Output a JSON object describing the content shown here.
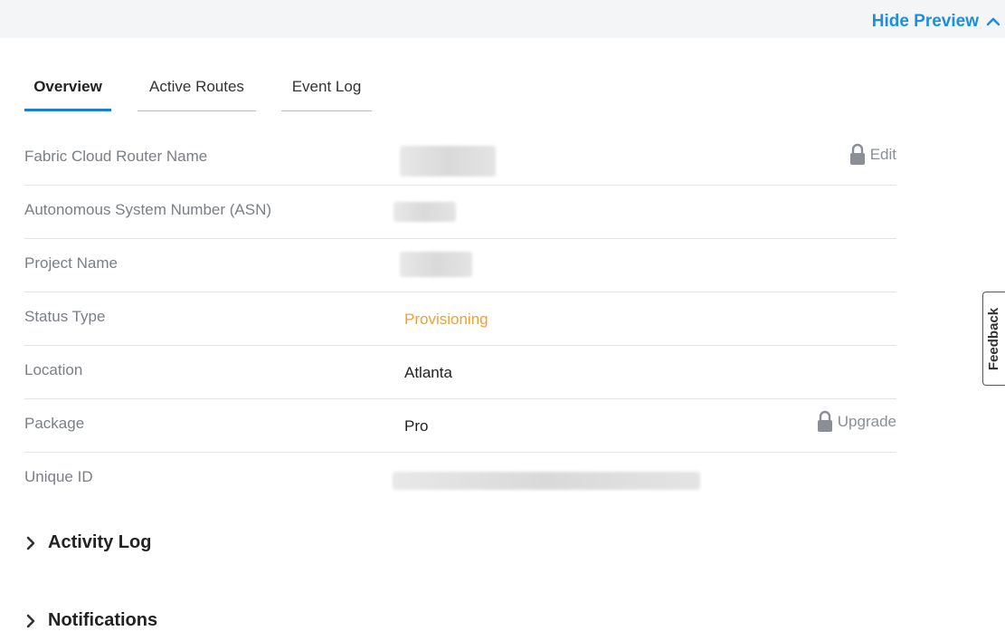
{
  "header": {
    "hide_preview_label": "Hide Preview"
  },
  "tabs": [
    {
      "label": "Overview",
      "active": true
    },
    {
      "label": "Active Routes",
      "active": false
    },
    {
      "label": "Event Log",
      "active": false
    }
  ],
  "details": [
    {
      "label": "Fabric Cloud Router Name",
      "value": "",
      "redacted": true,
      "action": "Edit"
    },
    {
      "label": "Autonomous System Number (ASN)",
      "value": "",
      "redacted": true
    },
    {
      "label": "Project Name",
      "value": "",
      "redacted": true
    },
    {
      "label": "Status Type",
      "value": "Provisioning",
      "color": "#f0a030"
    },
    {
      "label": "Location",
      "value": "Atlanta"
    },
    {
      "label": "Package",
      "value": "Pro",
      "action": "Upgrade"
    },
    {
      "label": "Unique ID",
      "value": "",
      "redacted": true
    }
  ],
  "sections": [
    {
      "label": "Activity Log",
      "expanded": false
    },
    {
      "label": "Notifications",
      "expanded": false
    }
  ],
  "feedback_label": "Feedback",
  "icons": {
    "hide_preview": "chevron-up-icon",
    "action": "lock-icon",
    "section": "chevron-right-icon"
  },
  "colors": {
    "accent": "#1a8fe3",
    "status_provisioning": "#f0a030",
    "active_tab_underline": "#1a7fd4"
  }
}
